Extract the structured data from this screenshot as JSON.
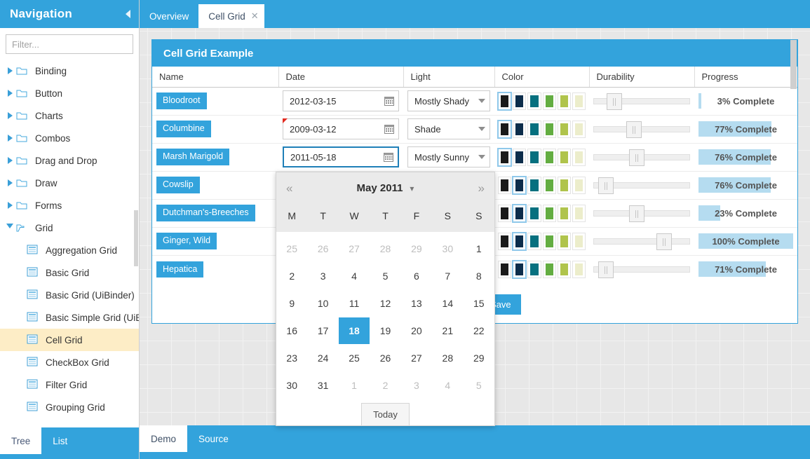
{
  "sidebar": {
    "title": "Navigation",
    "collapse_icon": "caret-left-icon",
    "filter": {
      "placeholder": "Filter...",
      "value": "",
      "clear_icon": "close-icon"
    },
    "tree": [
      {
        "label": "Binding",
        "type": "folder",
        "open": false,
        "depth": 0
      },
      {
        "label": "Button",
        "type": "folder",
        "open": false,
        "depth": 0
      },
      {
        "label": "Charts",
        "type": "folder",
        "open": false,
        "depth": 0
      },
      {
        "label": "Combos",
        "type": "folder",
        "open": false,
        "depth": 0
      },
      {
        "label": "Drag and Drop",
        "type": "folder",
        "open": false,
        "depth": 0
      },
      {
        "label": "Draw",
        "type": "folder",
        "open": false,
        "depth": 0
      },
      {
        "label": "Forms",
        "type": "folder",
        "open": false,
        "depth": 0
      },
      {
        "label": "Grid",
        "type": "folder",
        "open": true,
        "depth": 0
      },
      {
        "label": "Aggregation Grid",
        "type": "doc",
        "depth": 1
      },
      {
        "label": "Basic Grid",
        "type": "doc",
        "depth": 1
      },
      {
        "label": "Basic Grid (UiBinder)",
        "type": "doc",
        "depth": 1
      },
      {
        "label": "Basic Simple Grid (UiBi",
        "type": "doc",
        "depth": 1
      },
      {
        "label": "Cell Grid",
        "type": "doc",
        "depth": 1,
        "selected": true
      },
      {
        "label": "CheckBox Grid",
        "type": "doc",
        "depth": 1
      },
      {
        "label": "Filter Grid",
        "type": "doc",
        "depth": 1
      },
      {
        "label": "Grouping Grid",
        "type": "doc",
        "depth": 1
      }
    ],
    "tabs": [
      {
        "label": "Tree",
        "active": true
      },
      {
        "label": "List",
        "active": false
      }
    ]
  },
  "top_tabs": [
    {
      "label": "Overview",
      "active": false,
      "closable": false
    },
    {
      "label": "Cell Grid",
      "active": true,
      "closable": true,
      "close_icon": "close-icon"
    }
  ],
  "bottom_tabs": [
    {
      "label": "Demo",
      "active": true
    },
    {
      "label": "Source",
      "active": false
    }
  ],
  "panel": {
    "title": "Cell Grid Example",
    "save_label": "Save",
    "columns": [
      "Name",
      "Date",
      "Light",
      "Color",
      "Durability",
      "Progress"
    ],
    "palette": [
      "#1a1a1a",
      "#0c2d4b",
      "#06707f",
      "#63ad41",
      "#b0c44c",
      "#ecedcb"
    ],
    "rows": [
      {
        "name": "Bloodroot",
        "date": "2012-03-15",
        "date_focus": false,
        "date_error": false,
        "light": "Mostly Shady",
        "color_index": 0,
        "durability": 22,
        "progress": 3
      },
      {
        "name": "Columbine",
        "date": "2009-03-12",
        "date_focus": false,
        "date_error": true,
        "light": "Shade",
        "color_index": 0,
        "durability": 42,
        "progress": 77
      },
      {
        "name": "Marsh Marigold",
        "date": "2011-05-18",
        "date_focus": true,
        "date_error": false,
        "light": "Mostly Sunny",
        "color_index": 0,
        "durability": 45,
        "progress": 76
      },
      {
        "name": "Cowslip",
        "date": "",
        "date_focus": false,
        "date_error": false,
        "light": "",
        "color_index": 1,
        "durability": 13,
        "progress": 76
      },
      {
        "name": "Dutchman's-Breeches",
        "date": "",
        "date_focus": false,
        "date_error": false,
        "light": "",
        "color_index": 1,
        "durability": 45,
        "progress": 23
      },
      {
        "name": "Ginger, Wild",
        "date": "",
        "date_focus": false,
        "date_error": false,
        "light": "",
        "color_index": 1,
        "durability": 73,
        "progress": 100
      },
      {
        "name": "Hepatica",
        "date": "",
        "date_focus": false,
        "date_error": false,
        "light": "",
        "color_index": 1,
        "durability": 13,
        "progress": 71
      }
    ],
    "progress_suffix": "% Complete"
  },
  "datepicker": {
    "prev_icon": "chevron-double-left-icon",
    "next_icon": "chevron-double-right-icon",
    "month_label": "May 2011",
    "month_chevron_icon": "chevron-down-icon",
    "dow": [
      "M",
      "T",
      "W",
      "T",
      "F",
      "S",
      "S"
    ],
    "weeks": [
      [
        {
          "d": "25",
          "muted": true
        },
        {
          "d": "26",
          "muted": true
        },
        {
          "d": "27",
          "muted": true
        },
        {
          "d": "28",
          "muted": true
        },
        {
          "d": "29",
          "muted": true
        },
        {
          "d": "30",
          "muted": true
        },
        {
          "d": "1",
          "muted": false
        }
      ],
      [
        {
          "d": "2"
        },
        {
          "d": "3"
        },
        {
          "d": "4"
        },
        {
          "d": "5"
        },
        {
          "d": "6"
        },
        {
          "d": "7"
        },
        {
          "d": "8"
        }
      ],
      [
        {
          "d": "9"
        },
        {
          "d": "10"
        },
        {
          "d": "11"
        },
        {
          "d": "12"
        },
        {
          "d": "13"
        },
        {
          "d": "14"
        },
        {
          "d": "15"
        }
      ],
      [
        {
          "d": "16"
        },
        {
          "d": "17"
        },
        {
          "d": "18",
          "selected": true
        },
        {
          "d": "19"
        },
        {
          "d": "20"
        },
        {
          "d": "21"
        },
        {
          "d": "22"
        }
      ],
      [
        {
          "d": "23"
        },
        {
          "d": "24"
        },
        {
          "d": "25"
        },
        {
          "d": "26"
        },
        {
          "d": "27"
        },
        {
          "d": "28"
        },
        {
          "d": "29"
        }
      ],
      [
        {
          "d": "30"
        },
        {
          "d": "31"
        },
        {
          "d": "1",
          "muted": true
        },
        {
          "d": "2",
          "muted": true
        },
        {
          "d": "3",
          "muted": true
        },
        {
          "d": "4",
          "muted": true
        },
        {
          "d": "5",
          "muted": true
        }
      ]
    ],
    "today_label": "Today"
  },
  "colors": {
    "accent": "#33a3dc",
    "selected_row": "#fdedc6",
    "progress_fill": "#b5dcf0",
    "background": "#e7e7e7"
  }
}
